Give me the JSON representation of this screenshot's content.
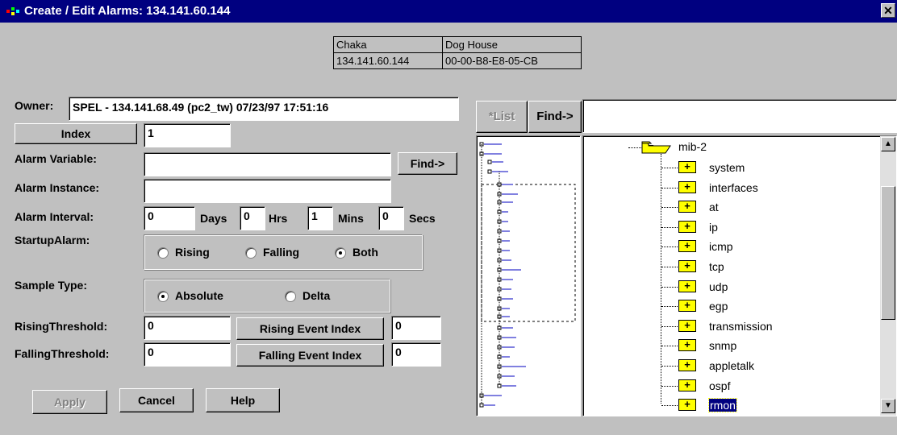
{
  "window": {
    "title": "Create / Edit Alarms: 134.141.60.144",
    "close_label": "✕"
  },
  "device": {
    "name": "Chaka",
    "location": "Dog House",
    "ip": "134.141.60.144",
    "mac": "00-00-B8-E8-05-CB"
  },
  "form": {
    "owner_label": "Owner:",
    "owner_value": "SPEL - 134.141.68.49 (pc2_tw) 07/23/97 17:51:16",
    "index_button": "Index",
    "index_value": "1",
    "alarm_variable_label": "Alarm Variable:",
    "alarm_variable_value": "",
    "find_button": "Find->",
    "alarm_instance_label": "Alarm Instance:",
    "alarm_instance_value": "",
    "alarm_interval_label": "Alarm Interval:",
    "interval": {
      "days_value": "0",
      "days_label": "Days",
      "hrs_value": "0",
      "hrs_label": "Hrs",
      "mins_value": "1",
      "mins_label": "Mins",
      "secs_value": "0",
      "secs_label": "Secs"
    },
    "startup_label": "StartupAlarm:",
    "startup_options": [
      "Rising",
      "Falling",
      "Both"
    ],
    "startup_selected": "Both",
    "sample_type_label": "Sample Type:",
    "sample_options": [
      "Absolute",
      "Delta"
    ],
    "sample_selected": "Absolute",
    "rising_threshold_label": "RisingThreshold:",
    "rising_threshold_value": "0",
    "rising_event_button": "Rising Event Index",
    "rising_event_value": "0",
    "falling_threshold_label": "FallingThreshold:",
    "falling_threshold_value": "0",
    "falling_event_button": "Falling Event Index",
    "falling_event_value": "0"
  },
  "buttons": {
    "apply": "Apply",
    "cancel": "Cancel",
    "help": "Help"
  },
  "mib_panel": {
    "list_button": "*List",
    "find_button": "Find->",
    "search_value": "",
    "root_node": "mib-2",
    "children": [
      "system",
      "interfaces",
      "at",
      "ip",
      "icmp",
      "tcp",
      "udp",
      "egp",
      "transmission",
      "snmp",
      "appletalk",
      "ospf",
      "rmon"
    ],
    "selected": "rmon",
    "expand_glyph": "+",
    "collapse_glyph": "−",
    "scroll_up_icon": "▲",
    "scroll_down_icon": "▼"
  },
  "colors": {
    "title_bar": "#000080",
    "window_bg": "#c0c0c0",
    "folder": "#ffff00",
    "selection": "#000080"
  }
}
